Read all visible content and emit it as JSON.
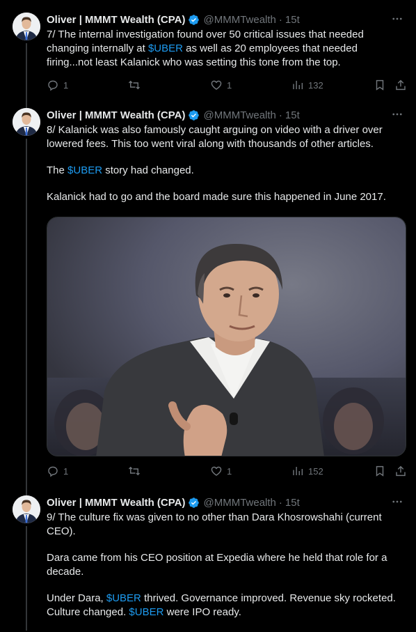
{
  "author": {
    "name": "Oliver | MMMT Wealth (CPA)",
    "handle": "@MMMTwealth",
    "separator": "·",
    "time": "15t"
  },
  "colors": {
    "background": "#000000",
    "text": "#e7e9ea",
    "muted": "#71767b",
    "link": "#1d9bf0",
    "verified": "#1d9bf0"
  },
  "tweets": [
    {
      "paragraphs": [
        [
          {
            "t": "7/ The internal investigation found over 50 critical issues that needed changing internally at "
          },
          {
            "t": "$UBER",
            "link": true
          },
          {
            "t": " as well as 20 employees that needed firing...not least Kalanick who was setting this tone from the top."
          }
        ]
      ],
      "replies": "1",
      "retweets": "",
      "likes": "1",
      "views": "132"
    },
    {
      "paragraphs": [
        [
          {
            "t": "8/ Kalanick was also famously caught arguing on video with a driver over lowered fees. This too went viral along with thousands of other articles."
          }
        ],
        [
          {
            "t": "The "
          },
          {
            "t": "$UBER",
            "link": true
          },
          {
            "t": " story had changed."
          }
        ],
        [
          {
            "t": "Kalanick had to go and the board made sure this happened in June 2017."
          }
        ]
      ],
      "replies": "1",
      "retweets": "",
      "likes": "1",
      "views": "152"
    },
    {
      "paragraphs": [
        [
          {
            "t": "9/ The culture fix was given to no other than Dara Khosrowshahi (current CEO)."
          }
        ],
        [
          {
            "t": "Dara came from his CEO position at Expedia where he held that role for a decade."
          }
        ],
        [
          {
            "t": "Under Dara, "
          },
          {
            "t": "$UBER",
            "link": true
          },
          {
            "t": " thrived. Governance improved. Revenue sky rocketed. Culture changed. "
          },
          {
            "t": "$UBER",
            "link": true
          },
          {
            "t": " were IPO ready."
          }
        ]
      ]
    }
  ]
}
